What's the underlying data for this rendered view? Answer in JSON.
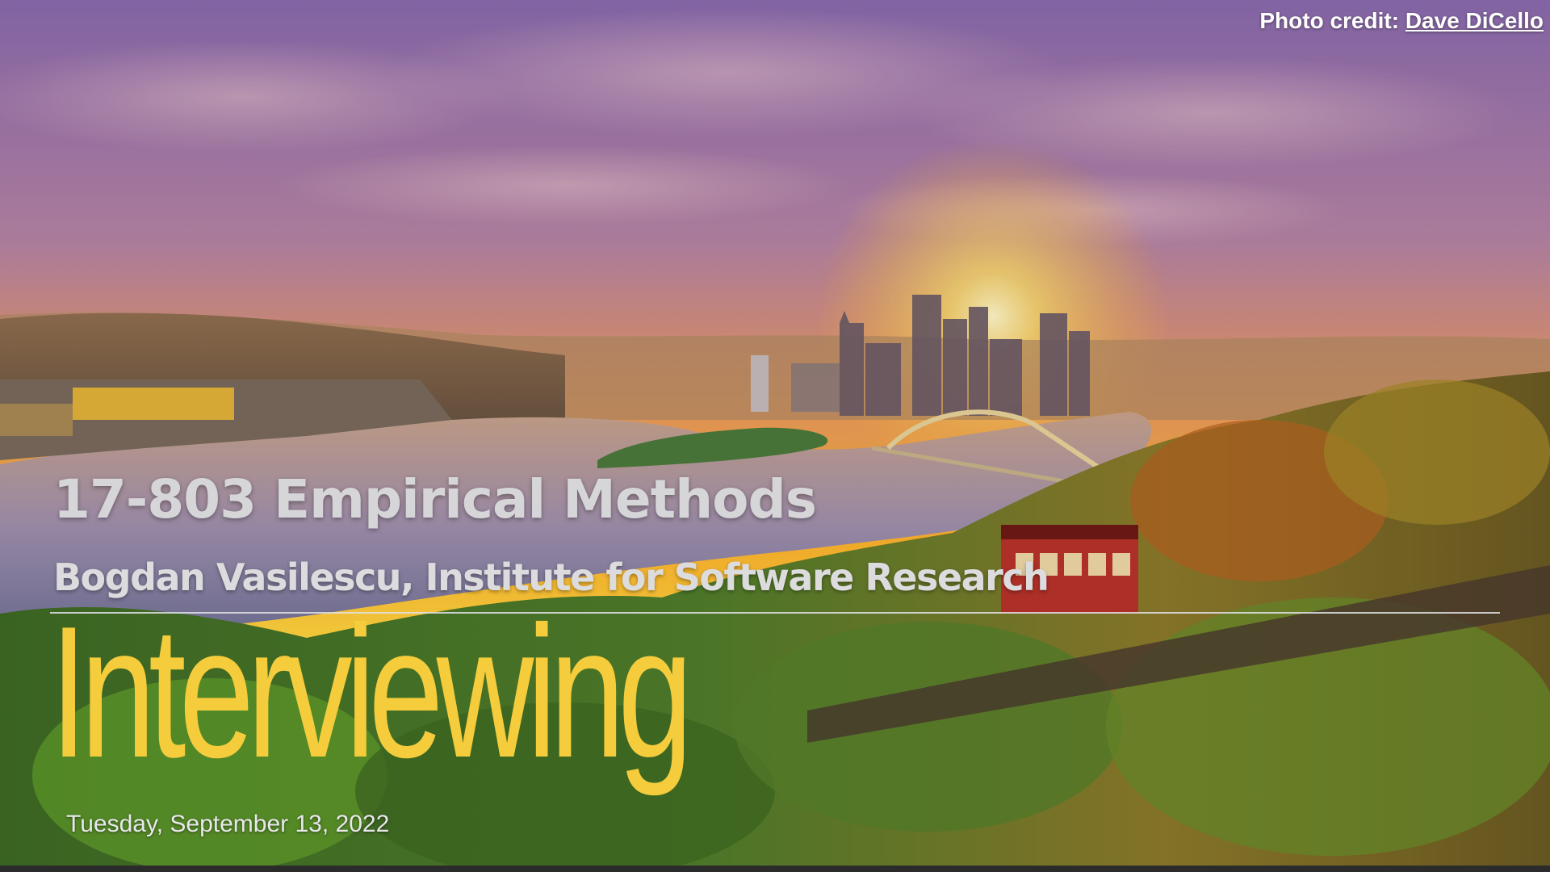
{
  "slide": {
    "photo_credit_label": "Photo credit:",
    "photo_credit_name": "Dave DiCello",
    "course": "17-803 Empirical Methods",
    "author": "Bogdan Vasilescu, Institute for Software Research",
    "title": "Interviewing",
    "date": "Tuesday, September 13, 2022"
  },
  "colors": {
    "title": "#f4cc3c",
    "subtitle": "#d6d6d9",
    "sky_top": "#8f6fb0",
    "sky_glow": "#ffb52e"
  }
}
